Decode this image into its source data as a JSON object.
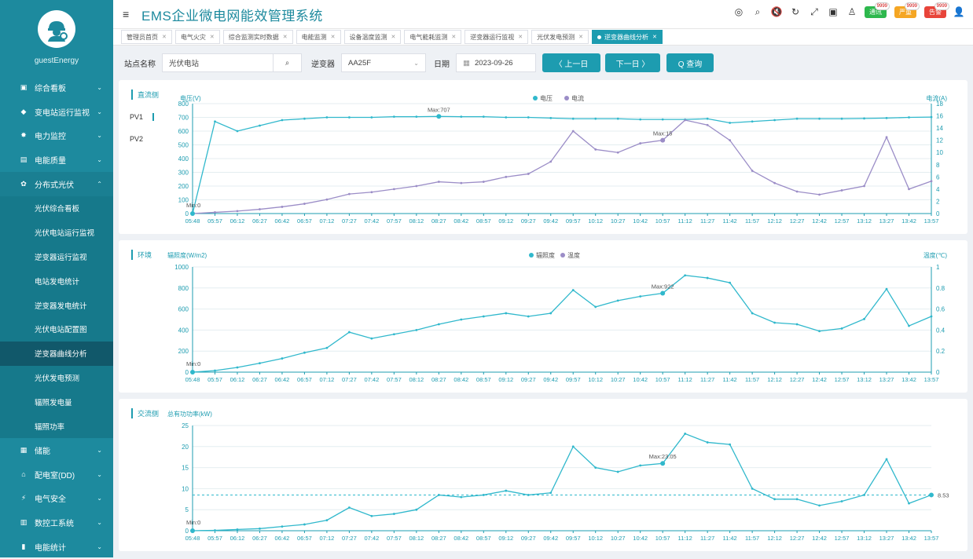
{
  "sidebar": {
    "username": "guestEnergy",
    "items": [
      {
        "label": "综合看板",
        "chevron": "⌄",
        "icon": "▣"
      },
      {
        "label": "变电站运行监视",
        "chevron": "⌄",
        "icon": "◆"
      },
      {
        "label": "电力监控",
        "chevron": "⌄",
        "icon": "✸"
      },
      {
        "label": "电能质量",
        "chevron": "⌄",
        "icon": "▤"
      },
      {
        "label": "分布式光伏",
        "chevron": "⌃",
        "icon": "✿"
      }
    ],
    "subitems": [
      "光伏综合看板",
      "光伏电站运行监视",
      "逆变器运行监视",
      "电站发电统计",
      "逆变器发电统计",
      "光伏电站配置图",
      "逆变器曲线分析",
      "光伏发电预测",
      "辐照发电量",
      "辐照功率"
    ],
    "active_sub_index": 6,
    "items_after": [
      {
        "label": "储能",
        "chevron": "⌄",
        "icon": "▦"
      },
      {
        "label": "配电室(DD)",
        "chevron": "⌄",
        "icon": "⌂"
      },
      {
        "label": "电气安全",
        "chevron": "⌄",
        "icon": "⚡"
      },
      {
        "label": "数控工系统",
        "chevron": "⌄",
        "icon": "▥"
      },
      {
        "label": "电能统计",
        "chevron": "⌄",
        "icon": "▮"
      }
    ]
  },
  "header": {
    "title": "EMS企业微电网能效管理系统",
    "badges": [
      {
        "label": "通讯",
        "color": "#2db84d",
        "count": "9999"
      },
      {
        "label": "严重",
        "color": "#f5a623",
        "count": "9999"
      },
      {
        "label": "告警",
        "color": "#e8443a",
        "count": "9999"
      }
    ]
  },
  "tabs": [
    {
      "label": "管理员首页"
    },
    {
      "label": "电气火灾"
    },
    {
      "label": "综合监测实时数据"
    },
    {
      "label": "电能监测"
    },
    {
      "label": "设备温度监测"
    },
    {
      "label": "电气能耗监测"
    },
    {
      "label": "逆变器运行监视"
    },
    {
      "label": "光伏发电预测"
    },
    {
      "label": "逆变器曲线分析",
      "active": true
    }
  ],
  "filters": {
    "station_label": "站点名称",
    "station_value": "光伏电站",
    "inverter_label": "逆变器",
    "inverter_value": "AA25F",
    "date_label": "日期",
    "date_value": "2023-09-26",
    "prev_day": "〈 上一日",
    "next_day": "下一日 〉",
    "query": "Q 查询"
  },
  "panels": {
    "dc": {
      "title": "直流侧",
      "tabs": [
        "PV1",
        "PV2"
      ]
    },
    "env": {
      "title": "环境"
    },
    "ac": {
      "title": "交流侧"
    }
  },
  "chart_data": [
    {
      "type": "line",
      "title": "直流侧 PV1",
      "ylabel": "电压(V)",
      "y2label": "电流(A)",
      "ylim": [
        0,
        800
      ],
      "y2lim": [
        0,
        18
      ],
      "legend": [
        "电压",
        "电流"
      ],
      "x": [
        "05:48",
        "05:57",
        "06:12",
        "06:27",
        "06:42",
        "06:57",
        "07:12",
        "07:27",
        "07:42",
        "07:57",
        "08:12",
        "08:27",
        "08:42",
        "08:57",
        "09:12",
        "09:27",
        "09:42",
        "09:57",
        "10:12",
        "10:27",
        "10:42",
        "10:57",
        "11:12",
        "11:27",
        "11:42",
        "11:57",
        "12:12",
        "12:27",
        "12:42",
        "12:57",
        "13:12",
        "13:27",
        "13:42",
        "13:57"
      ],
      "series": [
        {
          "name": "电压",
          "axis": "left",
          "color": "#30b8cc",
          "values": [
            0,
            670,
            600,
            640,
            680,
            690,
            700,
            700,
            700,
            705,
            705,
            707,
            705,
            705,
            700,
            700,
            695,
            690,
            690,
            690,
            685,
            685,
            685,
            690,
            660,
            670,
            680,
            690,
            690,
            690,
            692,
            695,
            700,
            702
          ]
        },
        {
          "name": "电流",
          "axis": "right",
          "color": "#9b8dc7",
          "values": [
            0,
            0.2,
            0.4,
            0.7,
            1.1,
            1.6,
            2.3,
            3.2,
            3.5,
            4.0,
            4.5,
            5.2,
            5.0,
            5.2,
            6.0,
            6.5,
            8.5,
            13.5,
            10.5,
            10.0,
            11.5,
            12.0,
            15.3,
            14.5,
            12.0,
            7.0,
            5.0,
            3.6,
            3.1,
            3.8,
            4.5,
            12.5,
            4.0,
            5.3
          ]
        }
      ],
      "annotations": [
        {
          "text": "Max:707",
          "x": "08:27",
          "series": "电压"
        },
        {
          "text": "Max:15",
          "x": "10:57",
          "series": "电流"
        },
        {
          "text": "Min:0",
          "x": "05:48",
          "series": "电压"
        }
      ]
    },
    {
      "type": "line",
      "title": "环境",
      "ylabel": "辐照度(W/m2)",
      "y2label": "温度(℃)",
      "ylim": [
        0,
        1000
      ],
      "y2lim": [
        0,
        1
      ],
      "legend": [
        "辐照度",
        "温度"
      ],
      "x": [
        "05:48",
        "05:57",
        "06:12",
        "06:27",
        "06:42",
        "06:57",
        "07:12",
        "07:27",
        "07:42",
        "07:57",
        "08:12",
        "08:27",
        "08:42",
        "08:57",
        "09:12",
        "09:27",
        "09:42",
        "09:57",
        "10:12",
        "10:27",
        "10:42",
        "10:57",
        "11:12",
        "11:27",
        "11:42",
        "11:57",
        "12:12",
        "12:27",
        "12:42",
        "12:57",
        "13:12",
        "13:27",
        "13:42",
        "13:57"
      ],
      "series": [
        {
          "name": "辐照度",
          "axis": "left",
          "color": "#30b8cc",
          "values": [
            0,
            15,
            45,
            85,
            130,
            185,
            230,
            380,
            320,
            360,
            400,
            455,
            500,
            530,
            560,
            530,
            560,
            780,
            620,
            680,
            720,
            750,
            920,
            895,
            850,
            560,
            470,
            455,
            390,
            415,
            505,
            790,
            440,
            530
          ]
        }
      ],
      "annotations": [
        {
          "text": "Max:922",
          "x": "10:57"
        },
        {
          "text": "Min:0",
          "x": "05:48"
        }
      ]
    },
    {
      "type": "line",
      "title": "交流侧",
      "ylabel": "总有功功率(kW)",
      "ylim": [
        0,
        25
      ],
      "legend": [],
      "x": [
        "05:48",
        "05:57",
        "06:12",
        "06:27",
        "06:42",
        "06:57",
        "07:12",
        "07:27",
        "07:42",
        "07:57",
        "08:12",
        "08:27",
        "08:42",
        "08:57",
        "09:12",
        "09:27",
        "09:42",
        "09:57",
        "10:12",
        "10:27",
        "10:42",
        "10:57",
        "11:12",
        "11:27",
        "11:42",
        "11:57",
        "12:12",
        "12:27",
        "12:42",
        "12:57",
        "13:12",
        "13:27",
        "13:42",
        "13:57"
      ],
      "series": [
        {
          "name": "总有功功率",
          "axis": "left",
          "color": "#30b8cc",
          "values": [
            0,
            0.1,
            0.3,
            0.5,
            1.0,
            1.5,
            2.5,
            5.5,
            3.5,
            4.0,
            5.0,
            8.5,
            8.0,
            8.5,
            9.5,
            8.5,
            9.0,
            20.0,
            15.0,
            14.0,
            15.5,
            16.0,
            23.05,
            21.0,
            20.5,
            10.0,
            7.5,
            7.5,
            6.0,
            7.0,
            8.5,
            17.0,
            6.5,
            8.5
          ]
        }
      ],
      "annotations": [
        {
          "text": "Max:23.05",
          "x": "10:57"
        },
        {
          "text": "Min:0",
          "x": "05:48"
        },
        {
          "text": "8.53",
          "x": "13:57"
        }
      ]
    }
  ]
}
